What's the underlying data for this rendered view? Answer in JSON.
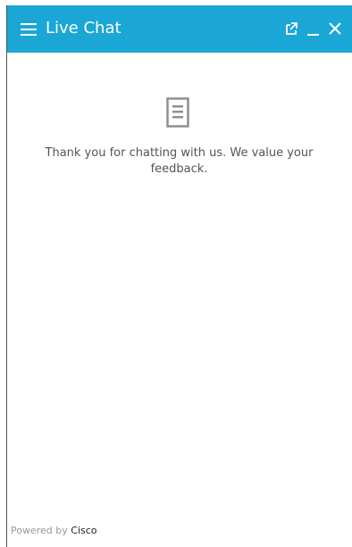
{
  "header": {
    "title": "Live Chat",
    "background_color": "#1aa7d6",
    "icons": {
      "menu": "hamburger-menu-icon",
      "popout": "external-window-icon",
      "minimize": "minimize-icon",
      "close": "close-icon"
    }
  },
  "main": {
    "icon": "document-icon",
    "message": "Thank you for chatting with us. We value your feedback."
  },
  "footer": {
    "powered_by": "Powered by",
    "brand": "Cisco"
  }
}
